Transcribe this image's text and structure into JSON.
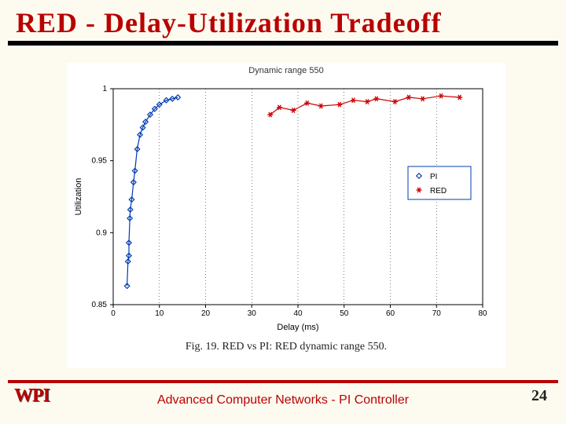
{
  "slide": {
    "title": "RED - Delay-Utilization Tradeoff",
    "footer_text": "Advanced Computer Networks -  PI Controller",
    "logo_text": "WPI",
    "page_number": "24"
  },
  "chart_data": {
    "type": "scatter",
    "title": "Dynamic range 550",
    "caption": "Fig. 19.  RED vs PI: RED dynamic range 550.",
    "xlabel": "Delay (ms)",
    "ylabel": "Utilization",
    "xlim": [
      0,
      80
    ],
    "ylim": [
      0.85,
      1.0
    ],
    "xticks": [
      0,
      10,
      20,
      30,
      40,
      50,
      60,
      70,
      80
    ],
    "yticks": [
      0.85,
      0.9,
      0.95,
      1.0
    ],
    "legend": {
      "entries": [
        "PI",
        "RED"
      ],
      "position": "right-middle"
    },
    "series": [
      {
        "name": "PI",
        "color": "#003cb3",
        "marker": "diamond",
        "line": true,
        "points": [
          [
            3.0,
            0.863
          ],
          [
            3.2,
            0.88
          ],
          [
            3.4,
            0.884
          ],
          [
            3.4,
            0.893
          ],
          [
            3.6,
            0.91
          ],
          [
            3.7,
            0.916
          ],
          [
            4.0,
            0.923
          ],
          [
            4.4,
            0.935
          ],
          [
            4.7,
            0.943
          ],
          [
            5.2,
            0.958
          ],
          [
            5.8,
            0.968
          ],
          [
            6.4,
            0.973
          ],
          [
            7.0,
            0.977
          ],
          [
            8.0,
            0.982
          ],
          [
            9.0,
            0.986
          ],
          [
            10.0,
            0.989
          ],
          [
            11.5,
            0.992
          ],
          [
            12.8,
            0.993
          ],
          [
            14.0,
            0.994
          ]
        ]
      },
      {
        "name": "RED",
        "color": "#cc0000",
        "marker": "asterisk",
        "line": true,
        "points": [
          [
            34.0,
            0.982
          ],
          [
            36.0,
            0.987
          ],
          [
            39.0,
            0.985
          ],
          [
            42.0,
            0.99
          ],
          [
            45.0,
            0.988
          ],
          [
            49.0,
            0.989
          ],
          [
            52.0,
            0.992
          ],
          [
            55.0,
            0.991
          ],
          [
            57.0,
            0.993
          ],
          [
            61.0,
            0.991
          ],
          [
            64.0,
            0.994
          ],
          [
            67.0,
            0.993
          ],
          [
            71.0,
            0.995
          ],
          [
            75.0,
            0.994
          ]
        ]
      }
    ]
  }
}
